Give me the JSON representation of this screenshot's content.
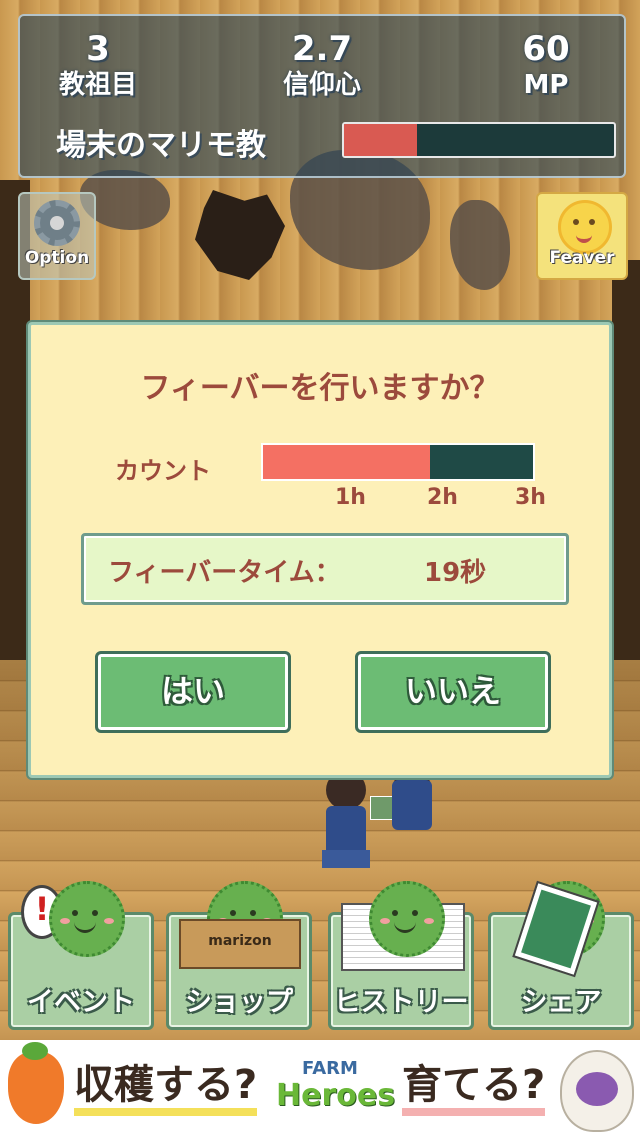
{
  "hud": {
    "generation_value": "3",
    "generation_label": "教祖目",
    "faith_value": "2.7",
    "faith_label": "信仰心",
    "mp_value": "60",
    "mp_label": "MP",
    "religion_name": "場末のマリモ教",
    "faith_progress": 0.27
  },
  "side_buttons": {
    "option_label": "Option",
    "feaver_label": "Feaver"
  },
  "dialog": {
    "title": "フィーバーを行いますか？",
    "count_label": "カウント",
    "count_progress": 0.62,
    "ticks": [
      "1h",
      "2h",
      "3h"
    ],
    "fever_time_label": "フィーバータイム：",
    "fever_time_value": "19秒",
    "yes_label": "はい",
    "no_label": "いいえ"
  },
  "menu": {
    "event_label": "イベント",
    "shop_label": "ショップ",
    "history_label": "ヒストリー",
    "share_label": "シェア",
    "shop_box_text": "marizon"
  },
  "ad": {
    "left_text": "収穫する?",
    "brand_top": "FARM",
    "brand_bottom": "Heroes",
    "right_text": "育てる?"
  },
  "colors": {
    "dialog_bg": "#fdf0b8",
    "accent_text": "#9c4a3c",
    "button_green": "#6cbc74",
    "bar_fill": "#f47063"
  }
}
